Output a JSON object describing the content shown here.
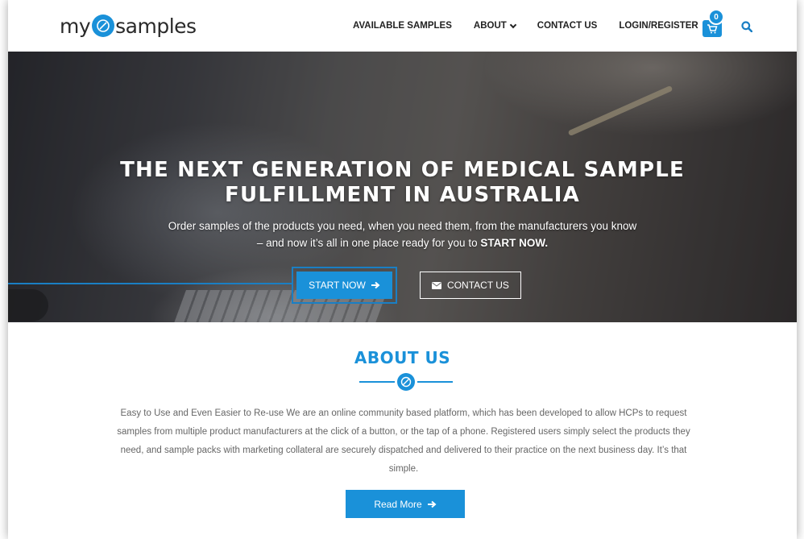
{
  "brand": {
    "logo_left": "my",
    "logo_right": "samples",
    "accent_color": "#1a91d9"
  },
  "nav": {
    "items": [
      {
        "label": "AVAILABLE SAMPLES"
      },
      {
        "label": "ABOUT"
      },
      {
        "label": "CONTACT US"
      },
      {
        "label": "LOGIN/REGISTER"
      }
    ],
    "cart_count": "0",
    "cart_icon": "cart-icon",
    "search_icon": "search-icon"
  },
  "hero": {
    "title_line1": "THE NEXT GENERATION OF MEDICAL SAMPLE",
    "title_line2": "FULFILLMENT IN AUSTRALIA",
    "sub_line1": "Order samples of the products you need, when you need them, from the manufacturers you know",
    "sub_line2": "– and now it’s all in one place ready for you to",
    "sub_emphasis": "START NOW.",
    "start_button": "START NOW",
    "contact_button": "CONTACT US"
  },
  "about": {
    "title": "ABOUT US",
    "body": "Easy to Use and Even Easier to Re-use We are an online community based platform, which has been developed to allow HCPs to request samples from multiple product manufacturers at the click of a button, or the tap of a phone. Registered users simply select the products they need, and sample packs with marketing collateral are securely dispatched and delivered to their practice on the next business day. It’s that simple.",
    "read_more_button": "Read More"
  }
}
